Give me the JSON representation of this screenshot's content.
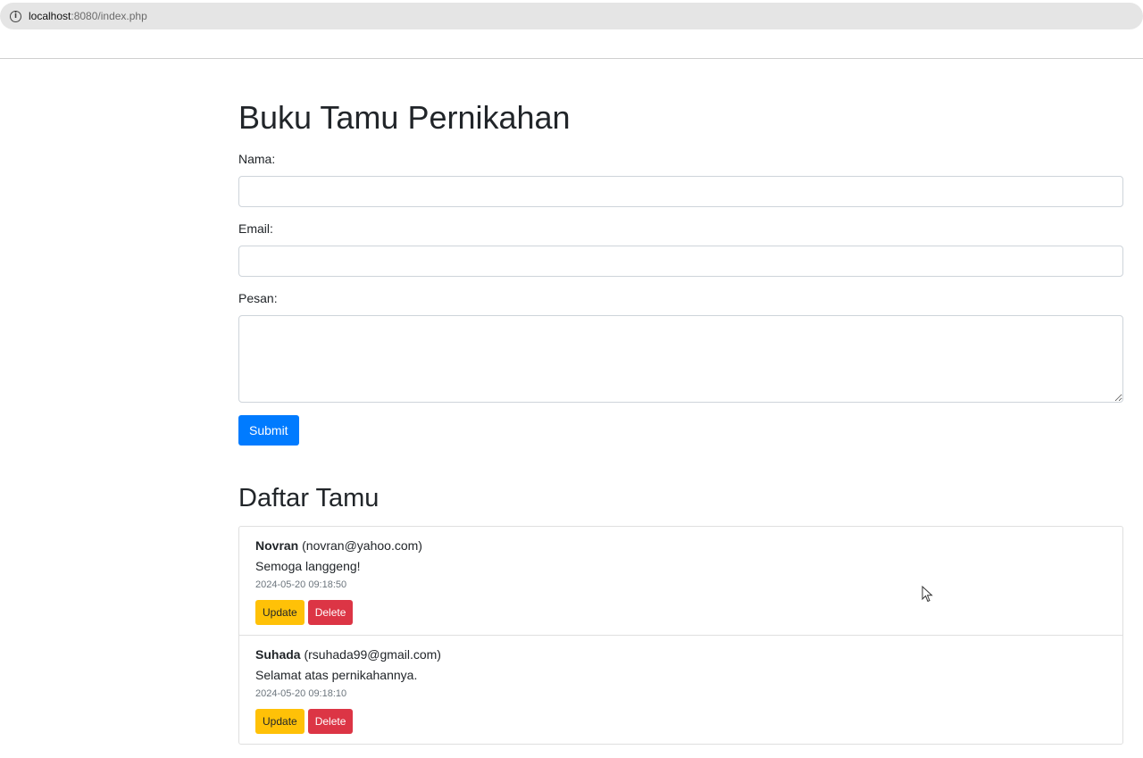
{
  "browser": {
    "url_host": "localhost",
    "url_rest": ":8080/index.php"
  },
  "page": {
    "title": "Buku Tamu Pernikahan"
  },
  "form": {
    "name_label": "Nama:",
    "name_value": "",
    "email_label": "Email:",
    "email_value": "",
    "message_label": "Pesan:",
    "message_value": "",
    "submit_label": "Submit"
  },
  "guest_list": {
    "title": "Daftar Tamu",
    "entries": [
      {
        "name": "Novran",
        "email": "(novran@yahoo.com)",
        "message": "Semoga langgeng!",
        "timestamp": "2024-05-20 09:18:50",
        "update_label": "Update",
        "delete_label": "Delete"
      },
      {
        "name": "Suhada",
        "email": "(rsuhada99@gmail.com)",
        "message": "Selamat atas pernikahannya.",
        "timestamp": "2024-05-20 09:18:10",
        "update_label": "Update",
        "delete_label": "Delete"
      }
    ]
  },
  "colors": {
    "primary": "#007bff",
    "warning": "#ffc107",
    "danger": "#dc3545"
  }
}
